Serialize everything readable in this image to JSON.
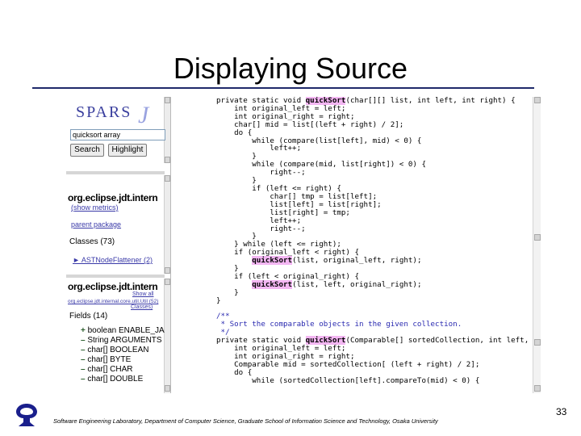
{
  "slide": {
    "title": "Displaying Source",
    "page_number": "33",
    "footer": "Software Engineering Laboratory, Department of Computer Science, Graduate School of Information Science and Technology, Osaka University"
  },
  "left_panel": {
    "logo_text": "SPARS",
    "logo_j": "J",
    "search_value": "quicksort array",
    "search_button": "Search",
    "highlight_button": "Highlight",
    "package_top": "org.eclipse.jdt.intern",
    "show_metrics": "(show metrics)",
    "parent_package": "parent package",
    "classes_label": "Classes (73)",
    "class_item": "► ASTNodeFlattener (2)",
    "package_bottom": "org.eclipse.jdt.intern",
    "show_all": "Show all",
    "class_path_link": "org.eclipse.jdt.internal.core.util.Util (52)",
    "classes_link": "Classes)",
    "fields_label": "Fields (14)",
    "fields": [
      {
        "prefix": "+",
        "text": "boolean ENABLE_JA"
      },
      {
        "prefix": "–",
        "text": "String ARGUMENTS"
      },
      {
        "prefix": "–",
        "text": "char[] BOOLEAN"
      },
      {
        "prefix": "–",
        "text": "char[] BYTE"
      },
      {
        "prefix": "–",
        "text": "char[] CHAR"
      },
      {
        "prefix": "–",
        "text": "char[] DOUBLE"
      }
    ]
  },
  "code": {
    "lines": [
      [
        {
          "t": "private static void "
        },
        {
          "t": "quickSort",
          "h": true
        },
        {
          "t": "(char[][] list, int left, int right) {"
        }
      ],
      [
        {
          "t": "    int original_left = left;"
        }
      ],
      [
        {
          "t": "    int original_right = right;"
        }
      ],
      [
        {
          "t": "    char[] mid = list[(left + right) / 2];"
        }
      ],
      [
        {
          "t": "    do {"
        }
      ],
      [
        {
          "t": "        while (compare(list[left], mid) < 0) {"
        }
      ],
      [
        {
          "t": "            left++;"
        }
      ],
      [
        {
          "t": "        }"
        }
      ],
      [
        {
          "t": "        while (compare(mid, list[right]) < 0) {"
        }
      ],
      [
        {
          "t": "            right--;"
        }
      ],
      [
        {
          "t": "        }"
        }
      ],
      [
        {
          "t": "        if (left <= right) {"
        }
      ],
      [
        {
          "t": "            char[] tmp = list[left];"
        }
      ],
      [
        {
          "t": "            list[left] = list[right];"
        }
      ],
      [
        {
          "t": "            list[right] = tmp;"
        }
      ],
      [
        {
          "t": "            left++;"
        }
      ],
      [
        {
          "t": "            right--;"
        }
      ],
      [
        {
          "t": "        }"
        }
      ],
      [
        {
          "t": "    } while (left <= right);"
        }
      ],
      [
        {
          "t": "    if (original_left < right) {"
        }
      ],
      [
        {
          "t": "        "
        },
        {
          "t": "quickSort",
          "h": true
        },
        {
          "t": "(list, original_left, right);"
        }
      ],
      [
        {
          "t": "    }"
        }
      ],
      [
        {
          "t": "    if (left < original_right) {"
        }
      ],
      [
        {
          "t": "        "
        },
        {
          "t": "quickSort",
          "h": true
        },
        {
          "t": "(list, left, original_right);"
        }
      ],
      [
        {
          "t": "    }"
        }
      ],
      [
        {
          "t": "}"
        }
      ],
      [
        {
          "t": ""
        }
      ],
      [
        {
          "t": "/**",
          "c": true
        }
      ],
      [
        {
          "t": " * Sort the comparable objects in the given collection.",
          "c": true
        }
      ],
      [
        {
          "t": " */",
          "c": true
        }
      ],
      [
        {
          "t": "private static void "
        },
        {
          "t": "quickSort",
          "h": true
        },
        {
          "t": "(Comparable[] sortedCollection, int left, int right) {"
        }
      ],
      [
        {
          "t": "    int original_left = left;"
        }
      ],
      [
        {
          "t": "    int original_right = right;"
        }
      ],
      [
        {
          "t": "    Comparable mid = sortedCollection[ (left + right) / 2];"
        }
      ],
      [
        {
          "t": "    do {"
        }
      ],
      [
        {
          "t": "        while (sortedCollection[left].compareTo(mid) < 0) {"
        }
      ]
    ]
  }
}
